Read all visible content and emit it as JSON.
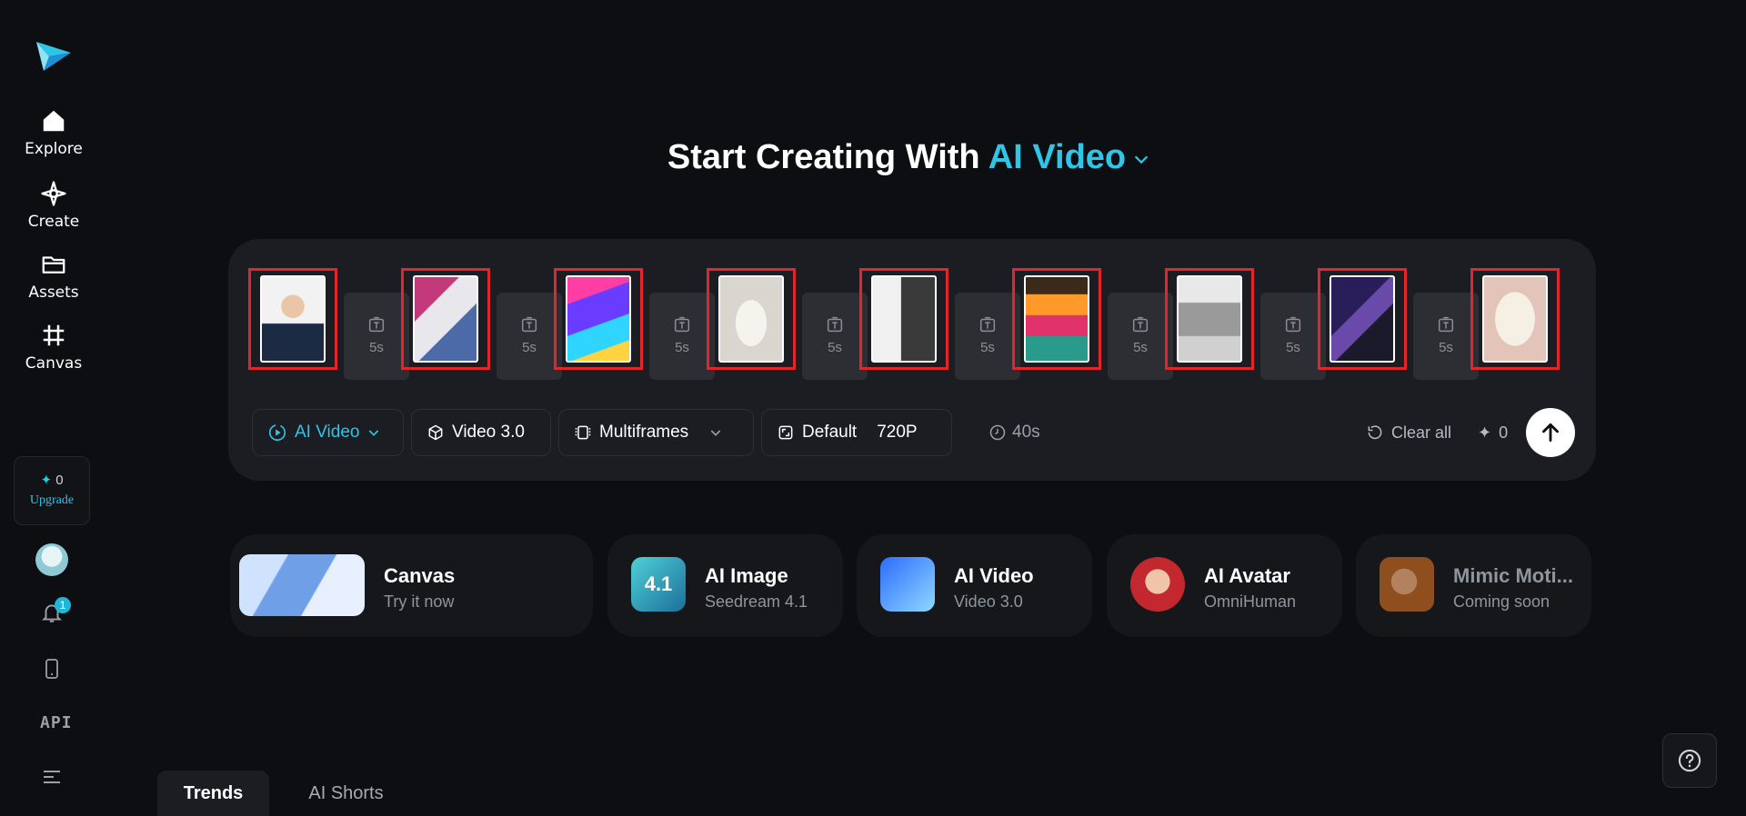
{
  "sidebar": {
    "nav": [
      {
        "label": "Explore",
        "icon": "home-icon"
      },
      {
        "label": "Create",
        "icon": "sparkle-icon"
      },
      {
        "label": "Assets",
        "icon": "folder-icon"
      },
      {
        "label": "Canvas",
        "icon": "frame-icon"
      }
    ],
    "credits": "0",
    "upgrade_label": "Upgrade",
    "notification_count": "1",
    "api_label": "API"
  },
  "heading": {
    "prefix": "Start Creating With",
    "mode": "AI Video"
  },
  "composer": {
    "frames": [
      {
        "icon": "portrait-man-suit"
      },
      {
        "icon": "portrait-woman-white-shirt"
      },
      {
        "icon": "anime-boy-colorful"
      },
      {
        "icon": "paper-cup"
      },
      {
        "icon": "sketch-woman-face"
      },
      {
        "icon": "festival-poster"
      },
      {
        "icon": "sketch-castle"
      },
      {
        "icon": "two-people-selfie"
      },
      {
        "icon": "floral-frame"
      }
    ],
    "transition_duration": "5s",
    "toolbar": {
      "mode_label": "AI Video",
      "model_label": "Video 3.0",
      "frames_label": "Multiframes",
      "ratio_label": "Default",
      "resolution_label": "720P",
      "duration_label": "40s",
      "clear_label": "Clear all",
      "cost": "0"
    }
  },
  "tools": [
    {
      "title": "Canvas",
      "subtitle": "Try it now",
      "icon": "pegasus-icon"
    },
    {
      "title": "AI Image",
      "subtitle": "Seedream 4.1",
      "icon": "seedream-icon",
      "badge_text": "4.1"
    },
    {
      "title": "AI Video",
      "subtitle": "Video 3.0",
      "icon": "video-icon"
    },
    {
      "title": "AI Avatar",
      "subtitle": "OmniHuman",
      "icon": "avatar-icon"
    },
    {
      "title": "Mimic Moti...",
      "subtitle": "Coming soon",
      "icon": "mimic-icon"
    }
  ],
  "tabs": [
    {
      "label": "Trends",
      "active": true
    },
    {
      "label": "AI Shorts",
      "active": false
    }
  ],
  "colors": {
    "accent": "#2ec5e6",
    "highlight_border": "#e3262b",
    "background": "#0d0e11"
  }
}
